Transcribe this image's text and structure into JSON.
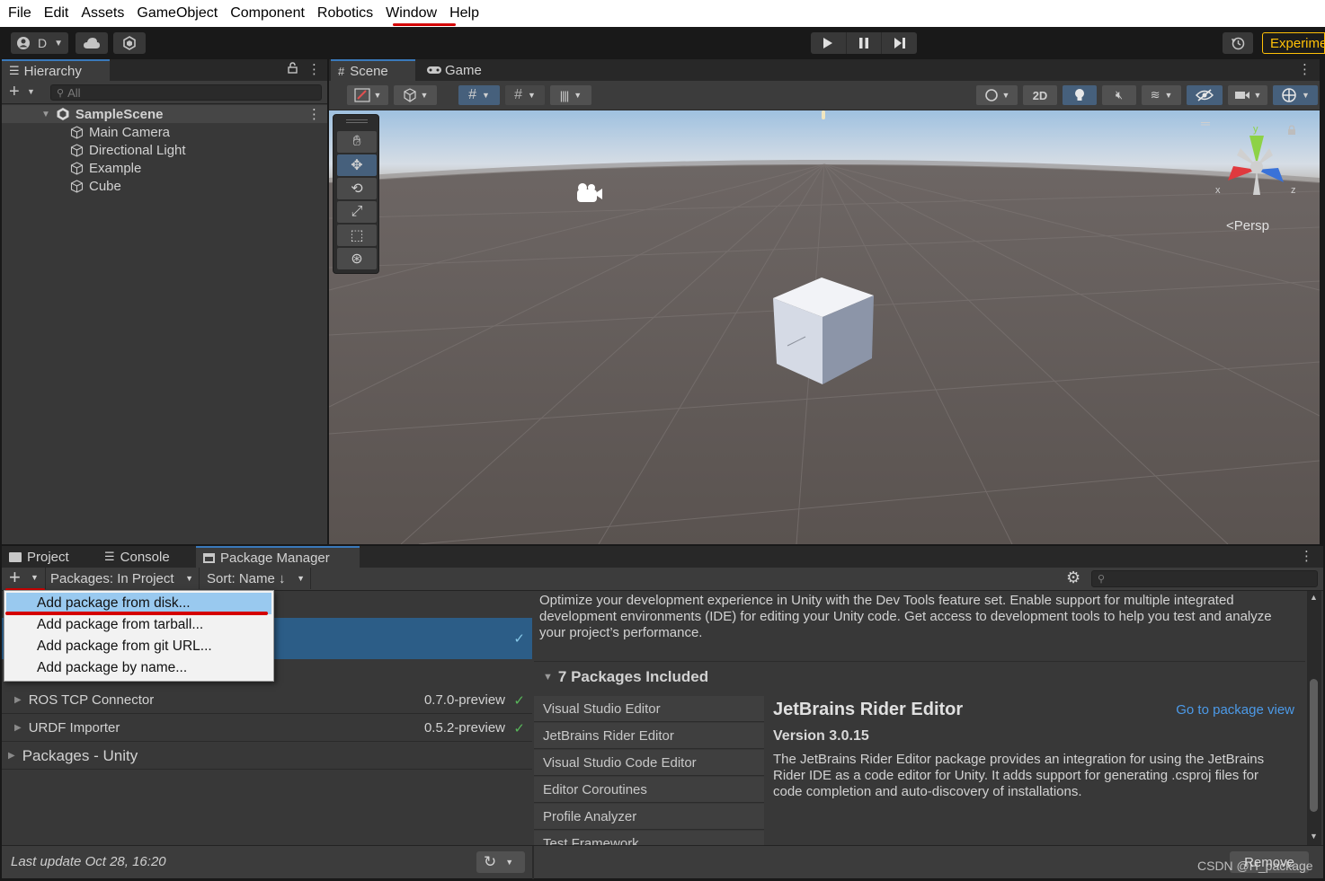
{
  "menu": [
    "File",
    "Edit",
    "Assets",
    "GameObject",
    "Component",
    "Robotics",
    "Window",
    "Help"
  ],
  "toolbar": {
    "account_label": "D",
    "experimental_label": "Experime",
    "accent_color": "#ffc107"
  },
  "hierarchy": {
    "tab_label": "Hierarchy",
    "search_placeholder": "All",
    "scene_name": "SampleScene",
    "objects": [
      "Main Camera",
      "Directional Light",
      "Example",
      "Cube"
    ]
  },
  "scene_view": {
    "tabs": [
      "Scene",
      "Game"
    ],
    "mode_2d": "2D",
    "projection": "Persp",
    "gizmo_axes": {
      "x": "x",
      "y": "y",
      "z": "z"
    }
  },
  "bottom_tabs": [
    "Project",
    "Console",
    "Package Manager"
  ],
  "package_manager": {
    "packages_filter": "Packages: In Project",
    "sort_label": "Sort: Name ↓",
    "add_menu": [
      "Add package from disk...",
      "Add package from tarball...",
      "Add package from git URL...",
      "Add package by name..."
    ],
    "packages": [
      {
        "name": "ROS TCP Connector",
        "version": "0.7.0-preview"
      },
      {
        "name": "URDF Importer",
        "version": "0.5.2-preview"
      }
    ],
    "group_unity": "Packages - Unity",
    "description": "Optimize your development experience in Unity with the Dev Tools feature set. Enable support for multiple integrated development environments (IDE) for editing your Unity code. Get access to development tools to help you test and analyze your project’s performance.",
    "included_header": "7 Packages Included",
    "included": [
      "Visual Studio Editor",
      "JetBrains Rider Editor",
      "Visual Studio Code Editor",
      "Editor Coroutines",
      "Profile Analyzer",
      "Test Framework"
    ],
    "selected": {
      "title": "JetBrains Rider Editor",
      "link": "Go to package view",
      "version": "Version 3.0.15",
      "description": "The JetBrains Rider Editor package provides an integration for using the JetBrains Rider IDE as a code editor for Unity. It adds support for generating .csproj files for code completion and auto-discovery of installations."
    },
    "last_update": "Last update Oct 28, 16:20",
    "remove_label": "Remove",
    "link_color": "#4c9ae8",
    "check_color": "#58b65a"
  },
  "watermark": "CSDN @H_package"
}
